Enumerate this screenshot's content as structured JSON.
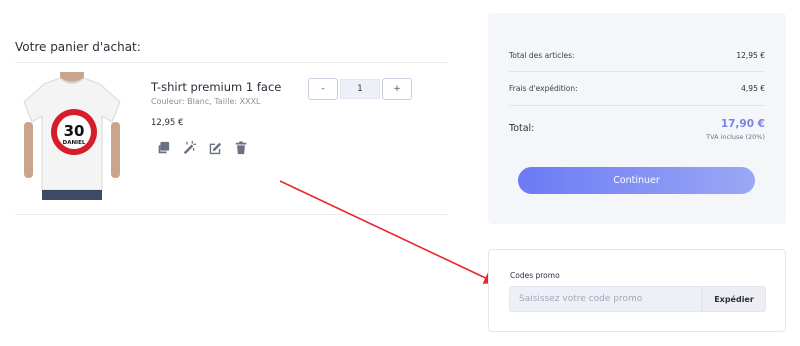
{
  "cart": {
    "title": "Votre panier d'achat:",
    "item": {
      "name": "T-shirt premium 1 face",
      "variant": "Couleur: Blanc, Taille: XXXL",
      "price": "12,95 €",
      "quantity": "1",
      "qty_minus": "-",
      "qty_plus": "+",
      "image": {
        "shirt_color": "#f4f4f4",
        "sign_number": "30",
        "sign_name": "DANIEL",
        "sign_ring_color": "#d61e2a"
      },
      "actions": [
        "duplicate-icon",
        "magic-wand-icon",
        "edit-icon",
        "trash-icon"
      ]
    }
  },
  "summary": {
    "items_label": "Total des articles:",
    "items_value": "12,95 €",
    "shipping_label": "Frais d'expédition:",
    "shipping_value": "4,95 €",
    "total_label": "Total:",
    "total_value": "17,90 €",
    "tax_note": "TVA incluse (20%)",
    "continue_label": "Continuer"
  },
  "promo": {
    "label": "Codes promo",
    "placeholder": "Saisissez votre code promo",
    "apply_label": "Expédier"
  },
  "colors": {
    "accent": "#7b83e3",
    "button_gradient_start": "#6c7af5",
    "button_gradient_end": "#9aa8f5",
    "annotation_arrow": "#e8262b",
    "summary_bg": "#f5f6fa"
  }
}
